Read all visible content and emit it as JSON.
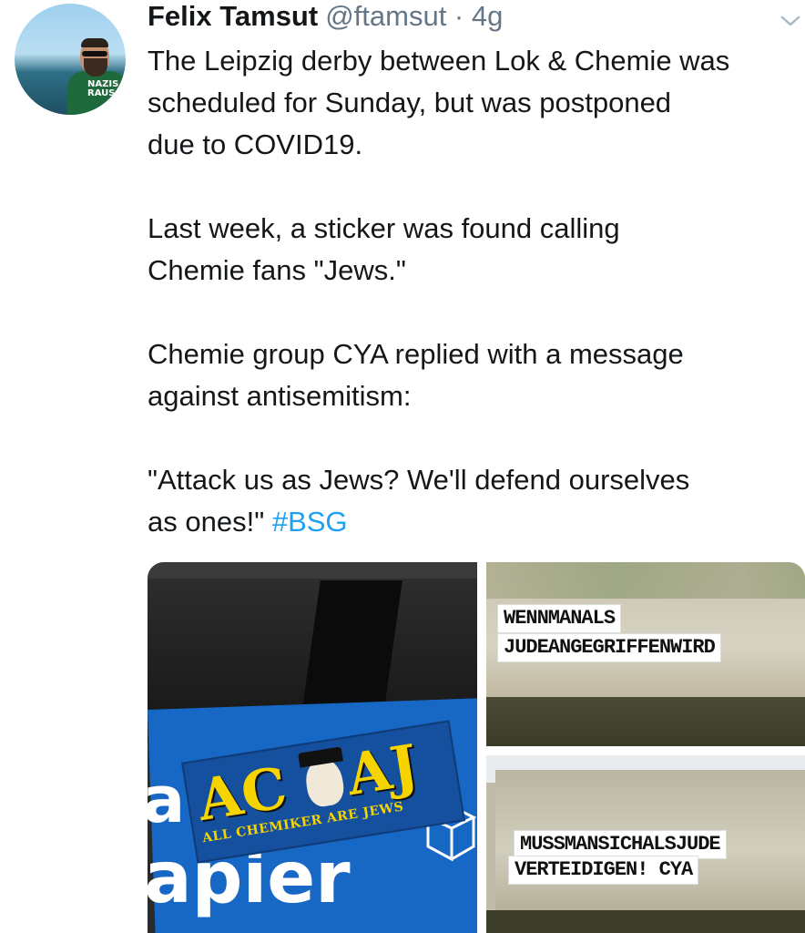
{
  "tweet": {
    "author_name": "Felix Tamsut",
    "handle_time": "@ftamsut · 4g",
    "lines": [
      "The Leipzig derby between Lok & Chemie was",
      "scheduled for Sunday, but was postponed",
      "due to COVID19.",
      "",
      "Last week, a sticker was found calling",
      "Chemie fans \"Jews.\"",
      "",
      "Chemie group CYA replied with a message",
      "against antisemitism:",
      "",
      "\"Attack us as Jews? We'll defend ourselves"
    ],
    "last_line_prefix": "as ones!\"",
    "hashtag": "#BSG",
    "hashtag_color": "#1da1f2"
  },
  "avatar": {
    "shirt_text_1": "NAZIS",
    "shirt_text_2": "RAUS"
  },
  "media": {
    "photo1": {
      "sticker_left": "AC",
      "sticker_right": "AJ",
      "sticker_subtitle": "ALL CHEMIKER ARE JEWS",
      "container_text_1": "a",
      "container_text_2": "apier"
    },
    "photo2": {
      "banner_line_1": "WENNMANALS",
      "banner_line_2": "JUDEANGEGRIFFENWIRD"
    },
    "photo3": {
      "banner_line_1": "MUSSMANSICHALSJUDE",
      "banner_line_2": "VERTEIDIGEN! CYA"
    }
  },
  "icons": {
    "menu": "chevron-down-icon"
  }
}
